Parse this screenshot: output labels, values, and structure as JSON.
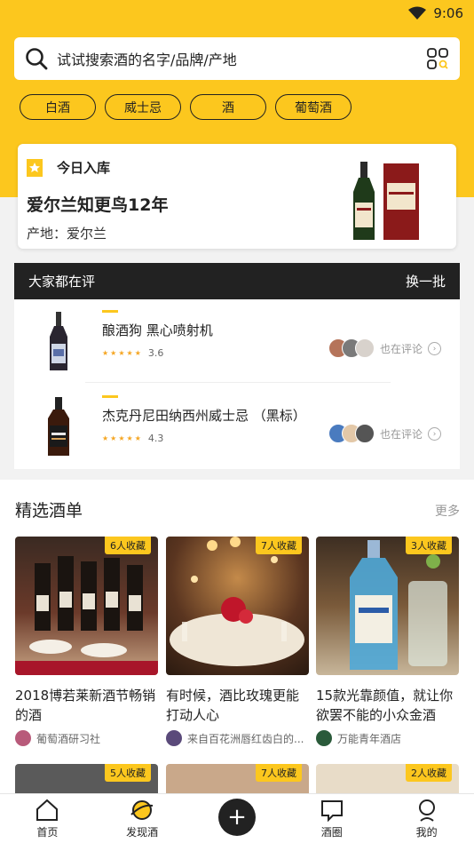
{
  "status_bar": {
    "time": "9:06"
  },
  "search": {
    "placeholder": "试试搜索酒的名字/品牌/产地"
  },
  "categories": [
    "白酒",
    "威士忌",
    "酒",
    "葡萄酒"
  ],
  "today": {
    "tag": "今日入库",
    "name": "爱尔兰知更鸟12年",
    "origin": "产地：爱尔兰"
  },
  "reviews": {
    "title": "大家都在评",
    "refresh": "换一批",
    "also_label": "也在评论",
    "items": [
      {
        "name": "酿酒狗 黑心喷射机",
        "stars": "★★★★★",
        "score": "3.6",
        "rating": 3.6
      },
      {
        "name": "杰克丹尼田纳西州威士忌 （黑标）",
        "stars": "★★★★★",
        "score": "4.3",
        "rating": 4.3
      }
    ]
  },
  "lists": {
    "title": "精选酒单",
    "more": "更多",
    "cards": [
      {
        "fav": "6人收藏",
        "title": "2018博若莱新酒节畅销的酒",
        "source": "葡萄酒研习社"
      },
      {
        "fav": "7人收藏",
        "title": "有时候，酒比玫瑰更能打动人心",
        "source": "来自百花洲唇红齿白的..."
      },
      {
        "fav": "3人收藏",
        "title": "15款光靠颜值，就让你欲罢不能的小众金酒",
        "source": "万能青年酒店"
      }
    ],
    "cards_row2": [
      {
        "fav": "5人收藏"
      },
      {
        "fav": "7人收藏"
      },
      {
        "fav": "2人收藏"
      }
    ]
  },
  "tabbar": [
    "首页",
    "发现酒",
    "",
    "酒圈",
    "我的"
  ],
  "colors": {
    "accent": "#fcc71e",
    "dark": "#222222"
  }
}
